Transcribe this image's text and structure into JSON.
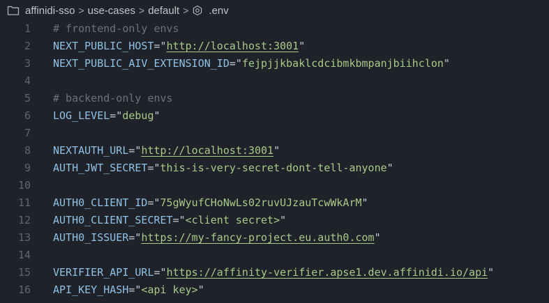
{
  "breadcrumb": {
    "items": [
      "affinidi-sso",
      "use-cases",
      "default"
    ],
    "file": ".env",
    "icons": [
      "folder-icon",
      "gear-icon"
    ],
    "separator": ">"
  },
  "editor": {
    "lines": [
      {
        "n": "1",
        "comment": "# frontend-only envs"
      },
      {
        "n": "2",
        "key": "NEXT_PUBLIC_HOST",
        "value": "http://localhost:3001",
        "link": true
      },
      {
        "n": "3",
        "key": "NEXT_PUBLIC_AIV_EXTENSION_ID",
        "value": "fejpjjkbaklcdcibmkbmpanjbiihclon"
      },
      {
        "n": "4"
      },
      {
        "n": "5",
        "comment": "# backend-only envs"
      },
      {
        "n": "6",
        "key": "LOG_LEVEL",
        "value": "debug"
      },
      {
        "n": "7"
      },
      {
        "n": "8",
        "key": "NEXTAUTH_URL",
        "value": "http://localhost:3001",
        "link": true
      },
      {
        "n": "9",
        "key": "AUTH_JWT_SECRET",
        "value": "this-is-very-secret-dont-tell-anyone"
      },
      {
        "n": "10"
      },
      {
        "n": "11",
        "key": "AUTH0_CLIENT_ID",
        "value": "75gWyufCHoNwLs02ruvUJzauTcwWkArM"
      },
      {
        "n": "12",
        "key": "AUTH0_CLIENT_SECRET",
        "value": "<client secret>"
      },
      {
        "n": "13",
        "key": "AUTH0_ISSUER",
        "value": "https://my-fancy-project.eu.auth0.com",
        "link": true
      },
      {
        "n": "14"
      },
      {
        "n": "15",
        "key": "VERIFIER_API_URL",
        "value": "https://affinity-verifier.apse1.dev.affinidi.io/api",
        "link": true
      },
      {
        "n": "16",
        "key": "API_KEY_HASH",
        "value": "<api key>"
      }
    ]
  },
  "colors": {
    "background": "#1f2228",
    "key": "#8fc1e6",
    "string": "#a8c98a",
    "comment": "#6b727d",
    "line_number": "#5f6570"
  }
}
